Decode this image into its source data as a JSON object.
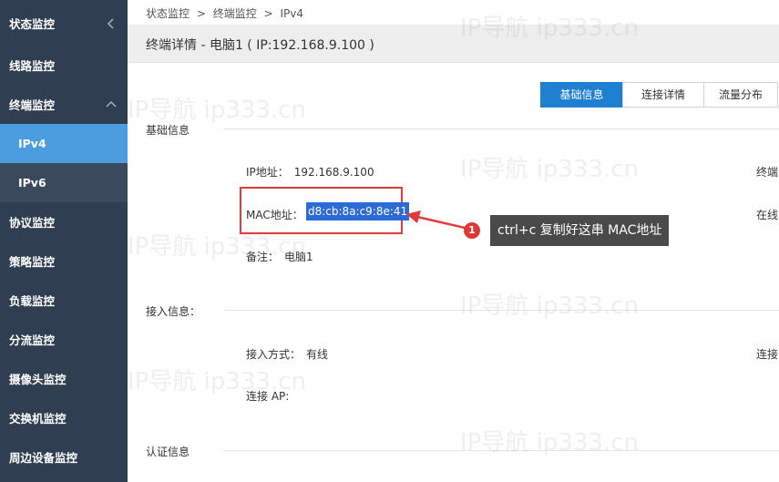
{
  "sidebar": {
    "items": [
      {
        "label": "状态监控"
      },
      {
        "label": "线路监控"
      },
      {
        "label": "终端监控"
      },
      {
        "label": "IPv4"
      },
      {
        "label": "IPv6"
      },
      {
        "label": "协议监控"
      },
      {
        "label": "策略监控"
      },
      {
        "label": "负载监控"
      },
      {
        "label": "分流监控"
      },
      {
        "label": "摄像头监控"
      },
      {
        "label": "交换机监控"
      },
      {
        "label": "周边设备监控"
      }
    ]
  },
  "breadcrumb": [
    "状态监控",
    ">",
    "终端监控",
    ">",
    "IPv4"
  ],
  "header": {
    "title": "终端详情 - 电脑1 ( IP:192.168.9.100 )"
  },
  "tabs": [
    {
      "label": "基础信息"
    },
    {
      "label": "连接详情"
    },
    {
      "label": "流量分布"
    }
  ],
  "basic": {
    "title": "基础信息",
    "ip_label": "IP地址：",
    "ip_value": "192.168.9.100",
    "mac_label": "MAC地址：",
    "mac_value": "d8:cb:8a:c9:8e:41",
    "note_label": "备注：",
    "note_value": "电脑1",
    "right_col_1": "终端",
    "right_col_2": "在线"
  },
  "access": {
    "title": "接入信息：",
    "method_label": "接入方式：",
    "method_value": "有线",
    "ap_label": "连接 AP:",
    "right_col": "连接"
  },
  "auth": {
    "title": "认证信息"
  },
  "callout": {
    "number": "1",
    "text": "ctrl+c 复制好这串 MAC地址"
  },
  "watermark": "IP导航  ip333.cn",
  "colors": {
    "sidebar_bg": "#2f3e50",
    "sidebar_active": "#4a9ee0",
    "tab_active": "#1f7fd0",
    "highlight": "#e23b3b",
    "selection": "#2d6ad6"
  }
}
